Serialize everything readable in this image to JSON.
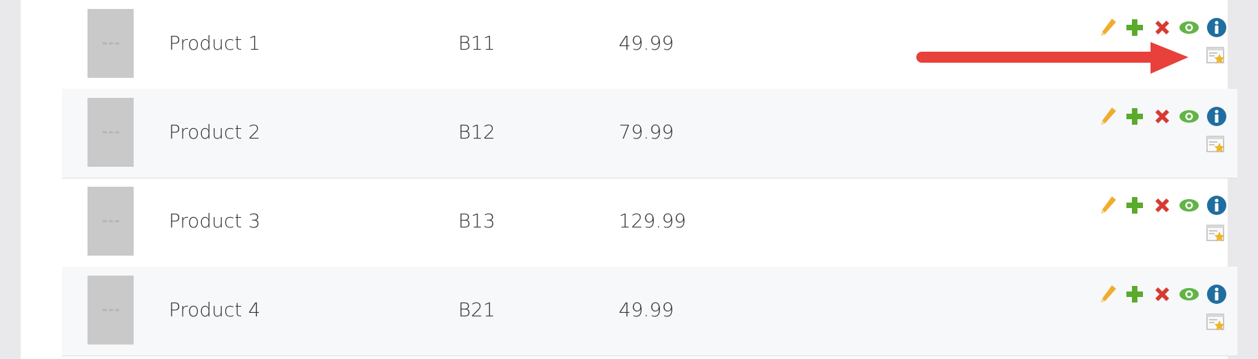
{
  "products": [
    {
      "name": "Product 1",
      "sku": "B11",
      "price": "49.99"
    },
    {
      "name": "Product 2",
      "sku": "B12",
      "price": "79.99"
    },
    {
      "name": "Product 3",
      "sku": "B13",
      "price": "129.99"
    },
    {
      "name": "Product 4",
      "sku": "B21",
      "price": "49.99"
    }
  ],
  "action_icons": [
    "pencil-icon",
    "plus-icon",
    "x-icon",
    "eye-icon",
    "info-icon",
    "featured-star-icon"
  ],
  "colors": {
    "edit": "#f0ad2d",
    "add": "#5aaa2c",
    "delete": "#d63b32",
    "view": "#62b447",
    "info": "#1f6e9f",
    "annotation_arrow": "#e8403b",
    "row_alt": "#f7f8fa"
  }
}
